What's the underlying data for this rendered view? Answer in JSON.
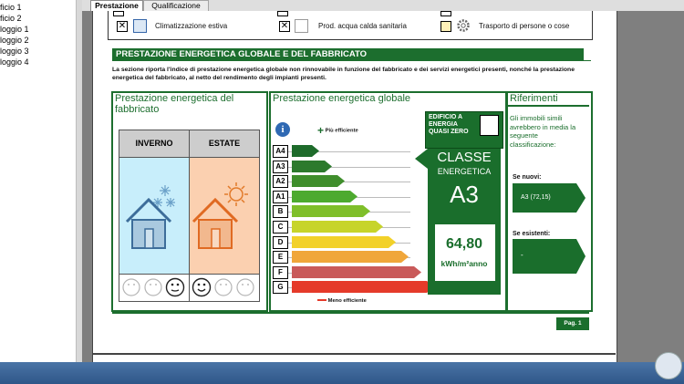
{
  "left_panel": {
    "items": [
      "ficio 1",
      "ficio 2",
      "loggio 1",
      "loggio 2",
      "loggio 3",
      "loggio 4"
    ]
  },
  "tabs": [
    {
      "label": "Prestazione",
      "active": true
    },
    {
      "label": "Qualificazione",
      "active": false
    }
  ],
  "header_row": {
    "items": [
      {
        "label": "Climatizzazione estiva",
        "checked": true
      },
      {
        "label": "Prod. acqua calda sanitaria",
        "checked": true
      },
      {
        "label": "Trasporto di persone o cose",
        "checked": false
      }
    ]
  },
  "section": {
    "title": "PRESTAZIONE ENERGETICA GLOBALE  E DEL FABBRICATO",
    "description": "La sezione riporta l'indice di prestazione energetica globale non rinnovabile in funzione del fabbricato e dei servizi energetici presenti, nonché la prestazione energetica del fabbricato, al netto del rendimento degli impianti presenti."
  },
  "panel_fabbricato": {
    "title": "Prestazione energetica del fabbricato",
    "col_winter": "INVERNO",
    "col_summer": "ESTATE"
  },
  "panel_globale": {
    "title": "Prestazione energetica globale",
    "legend_top": "Più efficiente",
    "legend_bottom": "Meno efficiente",
    "classes": [
      {
        "label": "A4",
        "color": "#1e6b2b"
      },
      {
        "label": "A3",
        "color": "#2d7a2d"
      },
      {
        "label": "A2",
        "color": "#3f8e2c"
      },
      {
        "label": "A1",
        "color": "#4daa2f"
      },
      {
        "label": "B",
        "color": "#7fbf2a"
      },
      {
        "label": "C",
        "color": "#c7d42a"
      },
      {
        "label": "D",
        "color": "#f2d12a"
      },
      {
        "label": "E",
        "color": "#f0a63a"
      },
      {
        "label": "F",
        "color": "#c95a5a"
      },
      {
        "label": "G",
        "color": "#e53a2a"
      }
    ],
    "nzeb_label": "EDIFICIO A ENERGIA QUASI ZERO",
    "classe_label": "CLASSE",
    "energetica_label": "ENERGETICA",
    "classe_value": "A3",
    "value": "64,80",
    "unit": "kWh/m²anno"
  },
  "panel_riferimenti": {
    "title": "Riferimenti",
    "text": "Gli immobili simili avrebbero in media la seguente classificazione:",
    "nuovi_label": "Se nuovi:",
    "nuovi_value": "A3  (72,15)",
    "esistenti_label": "Se esistenti:",
    "esistenti_value": "-"
  },
  "footer": {
    "page": "Pag. 1"
  },
  "colors": {
    "green_dark": "#1c6e2e",
    "winter_bg": "#c8eefb",
    "summer_bg": "#fbd0b0"
  }
}
